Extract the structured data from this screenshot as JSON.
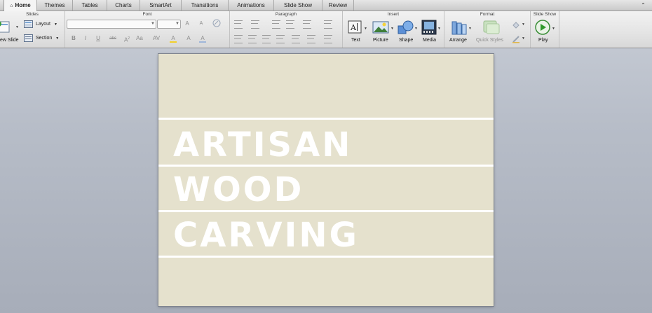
{
  "tabs": [
    {
      "label": "Home",
      "active": true
    },
    {
      "label": "Themes",
      "active": false
    },
    {
      "label": "Tables",
      "active": false
    },
    {
      "label": "Charts",
      "active": false
    },
    {
      "label": "SmartArt",
      "active": false
    },
    {
      "label": "Transitions",
      "active": false
    },
    {
      "label": "Animations",
      "active": false
    },
    {
      "label": "Slide Show",
      "active": false
    },
    {
      "label": "Review",
      "active": false
    }
  ],
  "ribbon": {
    "groups": {
      "slides": "Slides",
      "font": "Font",
      "paragraph": "Paragraph",
      "insert": "Insert",
      "format": "Format",
      "slide_show": "Slide Show"
    },
    "slides": {
      "new_slide": "ew Slide",
      "layout": "Layout",
      "section": "Section"
    },
    "font": {
      "bold": "B",
      "italic": "I",
      "underline": "U",
      "strike": "abc",
      "grow": "A",
      "shrink": "A",
      "text_color": "A",
      "font_value": "",
      "size_value": ""
    },
    "insert": {
      "text": "Text",
      "picture": "Picture",
      "shape": "Shape",
      "media": "Media"
    },
    "format": {
      "arrange": "Arrange",
      "quick_styles": "Quick Styles"
    },
    "slide_show": {
      "play": "Play"
    }
  },
  "slide": {
    "title_lines": [
      "ARTISAN",
      "WOOD",
      "CARVING"
    ],
    "background": "#e5e1cd",
    "text_color": "#ffffff"
  },
  "icons": [
    "home-icon",
    "new-slide-icon",
    "layout-icon",
    "section-icon",
    "text-box-icon",
    "picture-icon",
    "shape-icon",
    "media-icon",
    "arrange-icon",
    "quick-styles-icon",
    "play-icon"
  ]
}
